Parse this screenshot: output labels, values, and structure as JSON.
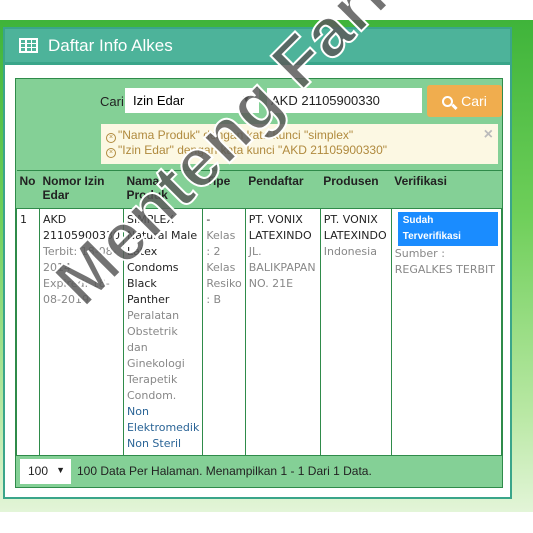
{
  "header": {
    "title": "Daftar Info Alkes",
    "icon": "table-grid-icon"
  },
  "search": {
    "label": "Cari",
    "select_value": "Izin Edar",
    "input_value": "AKD 21105900330",
    "button_label": "Cari"
  },
  "filters": [
    "\"Nama Produk\" dengan kata kunci \"simplex\"",
    "\"Izin Edar\" dengan kata kunci \"AKD 21105900330\""
  ],
  "close_label": "×",
  "table": {
    "headers": [
      "No",
      "Nomor Izin Edar",
      "Nama Produk",
      "Tipe",
      "Pendaftar",
      "Produsen",
      "Verifikasi"
    ],
    "rows": [
      {
        "no": "1",
        "izin": "AKD 21105900330",
        "terbit": "Terbit: 18-08-2014",
        "expired": "Expired: 18-08-2019",
        "nama": "SIMPLEX Natural Male Latex Condoms Black Panther",
        "kategori": "Peralatan Obstetrik dan Ginekologi Terapetik Condom.",
        "subkategori": "Non Elektromedik Non Steril",
        "tipe": "-",
        "kelas": "Kelas : 2",
        "resiko": "Kelas Resiko : B",
        "pendaftar": "PT. VONIX LATEXINDO",
        "alamat": "JL. BALIKPAPAN NO. 21E",
        "produsen": "PT. VONIX LATEXINDO",
        "negara": "Indonesia",
        "status": "Sudah Terverifikasi",
        "sumber": "Sumber : REGALKES TERBIT"
      }
    ]
  },
  "footer": {
    "per_page": "100",
    "summary": "100 Data Per Halaman. Menampilkan 1 - 1 Dari 1 Data."
  },
  "watermark": "Menteng Farma",
  "colors": {
    "header": "#4db39a",
    "inner": "#84d096",
    "button": "#f0ad4e",
    "badge": "#1a8cff"
  }
}
